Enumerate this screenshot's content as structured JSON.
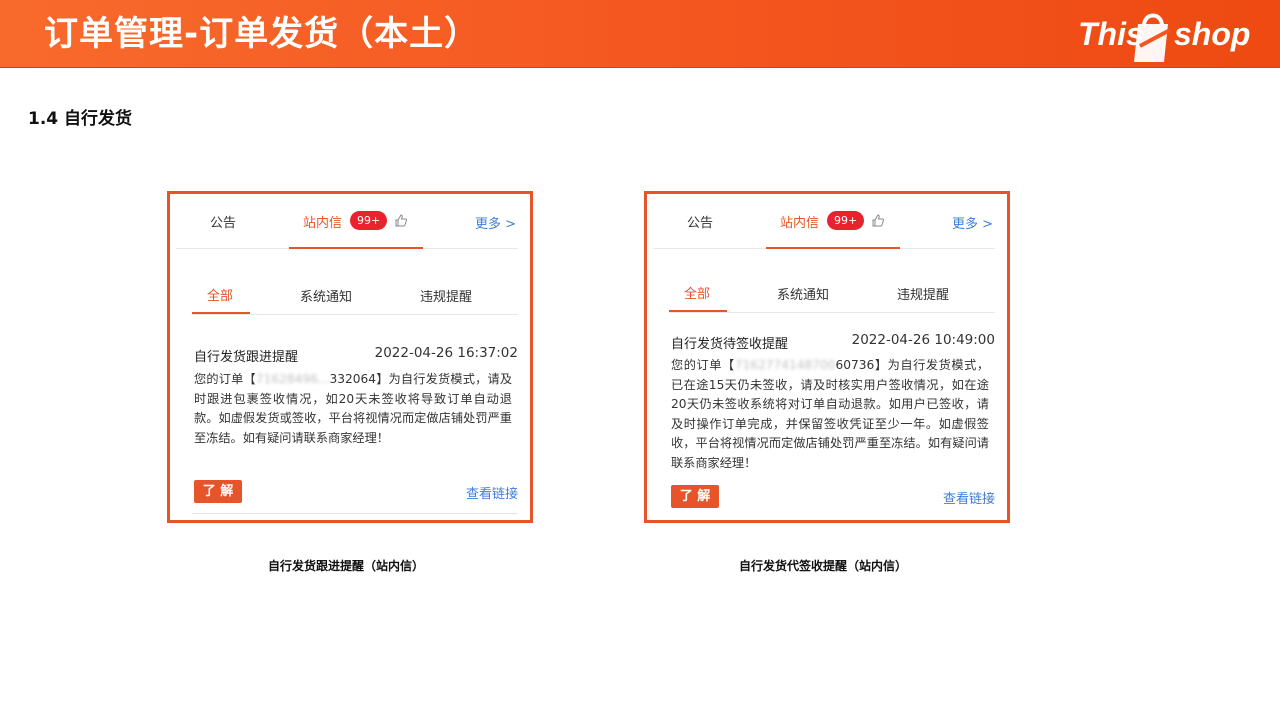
{
  "header": {
    "title": "订单管理-订单发货（本土）",
    "logo": {
      "part1": "This",
      "part2": "shop"
    },
    "colors": {
      "banner": "#f4561f",
      "accent": "#e8542a",
      "link": "#3c7fd8",
      "badge": "#e8232e"
    }
  },
  "section": {
    "heading": "1.4 自行发货"
  },
  "cards": [
    {
      "tabs": {
        "notice": "公告",
        "inbox": "站内信",
        "badge": "99+",
        "more": "更多 >"
      },
      "subtabs": {
        "all": "全部",
        "system": "系统通知",
        "violation": "违规提醒"
      },
      "message": {
        "title": "自行发货跟进提醒",
        "time": "2022-04-26 16:37:02",
        "body_prefix": "您的订单【",
        "order_id": "71628496...",
        "order_tail": "332064",
        "body_suffix": "】为自行发货模式，请及时跟进包裹签收情况，如20天未签收将导致订单自动退款。如虚假发货或签收，平台将视情况而定做店铺处罚严重至冻结。如有疑问请联系商家经理！"
      },
      "learn_button": "了 解",
      "view_link": "查看链接",
      "caption": "自行发货跟进提醒（站内信）"
    },
    {
      "tabs": {
        "notice": "公告",
        "inbox": "站内信",
        "badge": "99+",
        "more": "更多 >"
      },
      "subtabs": {
        "all": "全部",
        "system": "系统通知",
        "violation": "违规提醒"
      },
      "message": {
        "title": "自行发货待签收提醒",
        "time": "2022-04-26 10:49:00",
        "body_prefix": "您的订单【",
        "order_id": "7162774148700",
        "order_tail": "60736",
        "body_suffix": "】为自行发货模式，已在途15天仍未签收，请及时核实用户签收情况，如在途20天仍未签收系统将对订单自动退款。如用户已签收，请及时操作订单完成，并保留签收凭证至少一年。如虚假签收，平台将视情况而定做店铺处罚严重至冻结。如有疑问请联系商家经理！"
      },
      "learn_button": "了 解",
      "view_link": "查看链接",
      "caption": "自行发货代签收提醒（站内信）"
    }
  ]
}
